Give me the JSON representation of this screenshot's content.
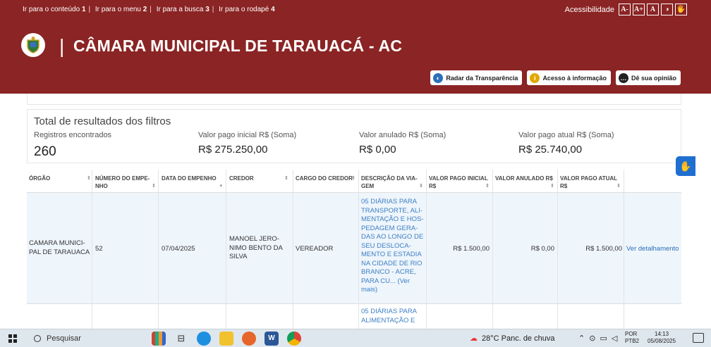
{
  "skip_links": [
    {
      "label": "Ir para o conteúdo",
      "key": "1"
    },
    {
      "label": "Ir para o menu",
      "key": "2"
    },
    {
      "label": "Ir para a busca",
      "key": "3"
    },
    {
      "label": "Ir para o rodapé",
      "key": "4"
    }
  ],
  "accessibility": {
    "label": "Acessibilidade",
    "buttons": [
      "A-",
      "A+",
      "A",
      "◑",
      "🖐"
    ]
  },
  "header": {
    "title": "CÂMARA MUNICIPAL DE TARAUACÁ - AC",
    "buttons": [
      {
        "label": "Radar da Transparência",
        "icon": "radar-icon",
        "color": "#2a6fb8"
      },
      {
        "label": "Acesso à informação",
        "icon": "info-icon",
        "color": "#e0a800"
      },
      {
        "label": "Dê sua opinião",
        "icon": "chat-icon",
        "color": "#222222"
      }
    ]
  },
  "summary": {
    "title": "Total de resultados dos filtros",
    "records_label": "Registros encontrados",
    "records_value": "260",
    "initial_label": "Valor pago inicial R$ (Soma)",
    "initial_value": "R$ 275.250,00",
    "annulled_label": "Valor anulado R$ (Soma)",
    "annulled_value": "R$ 0,00",
    "current_label": "Valor pago atual R$ (Soma)",
    "current_value": "R$ 25.740,00"
  },
  "table": {
    "headers": [
      "ÓRGÃO",
      "NÚMERO DO EMPE-\nNHO",
      "DATA DO EMPENHO",
      "CREDOR",
      "CARGO DO CREDOR",
      "DESCRIÇÃO DA VIA-\nGEM",
      "VALOR PAGO INICIAL\nR$",
      "VALOR ANULADO R$",
      "VALOR PAGO ATUAL\nR$"
    ],
    "rows": [
      {
        "orgao": "CAMARA MUNICI-\nPAL DE TARAUACA",
        "numero": "52",
        "data": "07/04/2025",
        "credor": "MANOEL JERO-\nNIMO BENTO DA\nSILVA",
        "cargo": "VEREADOR",
        "descricao": "05 DIÁRIAS PARA\nTRANSPORTE, ALI-\nMENTAÇÃO E HOS-\nPEDAGEM GERA-\nDAS AO LONGO DE\nSEU DESLOCA-\nMENTO E ESTADIA\nNA CIDADE DE RIO\nBRANCO - ACRE,\nPARA CU... (Ver\nmais)",
        "valor_inicial": "R$ 1.500,00",
        "valor_anulado": "R$ 0,00",
        "valor_atual": "R$ 1.500,00",
        "acao": "Ver detalhamento"
      },
      {
        "descricao": "05 DIÁRIAS PARA\nALIMENTAÇÃO E"
      }
    ]
  },
  "taskbar": {
    "search_placeholder": "Pesquisar",
    "weather": "28°C  Panc. de chuva",
    "lang_top": "POR",
    "lang_bottom": "PTB2",
    "time": "14:13",
    "date": "05/08/2025"
  }
}
